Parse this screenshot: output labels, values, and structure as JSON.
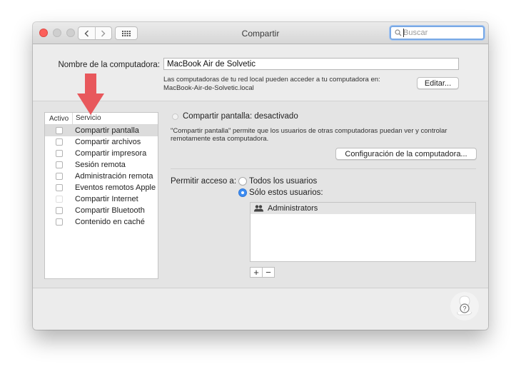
{
  "window": {
    "title": "Compartir"
  },
  "search": {
    "placeholder": "Buscar",
    "value": ""
  },
  "computer_name": {
    "label": "Nombre de la computadora:",
    "value": "MacBook Air de Solvetic",
    "description_line1": "Las computadoras de tu red local pueden acceder a tu computadora en:",
    "description_line2": "MacBook-Air-de-Solvetic.local",
    "edit_label": "Editar..."
  },
  "services": {
    "header_active": "Activo",
    "header_service": "Servicio",
    "items": [
      {
        "label": "Compartir pantalla",
        "checked": false,
        "selected": true
      },
      {
        "label": "Compartir archivos",
        "checked": false
      },
      {
        "label": "Compartir impresora",
        "checked": false
      },
      {
        "label": "Sesión remota",
        "checked": false
      },
      {
        "label": "Administración remota",
        "checked": false
      },
      {
        "label": "Eventos remotos Apple",
        "checked": false
      },
      {
        "label": "Compartir Internet",
        "checked": false,
        "disabled": true
      },
      {
        "label": "Compartir Bluetooth",
        "checked": false
      },
      {
        "label": "Contenido en caché",
        "checked": false
      }
    ]
  },
  "detail": {
    "status": "Compartir pantalla: desactivado",
    "description_line1": "\"Compartir pantalla\" permite que los usuarios de otras computadoras puedan ver y controlar",
    "description_line2": "remotamente esta computadora.",
    "config_button": "Configuración de la computadora...",
    "access_label": "Permitir acceso a:",
    "option_all": "Todos los usuarios",
    "option_only": "Sólo estos usuarios:",
    "selected_option": "only",
    "users": [
      "Administrators"
    ],
    "add_label": "+",
    "remove_label": "−"
  },
  "colors": {
    "accent": "#3c8cf2",
    "annotation_arrow": "#e8585c",
    "close_button": "#fc605b"
  },
  "icons": [
    "back-chevron-icon",
    "forward-chevron-icon",
    "grid-icon",
    "search-icon",
    "group-users-icon",
    "help-icon",
    "annotation-arrow-icon"
  ]
}
